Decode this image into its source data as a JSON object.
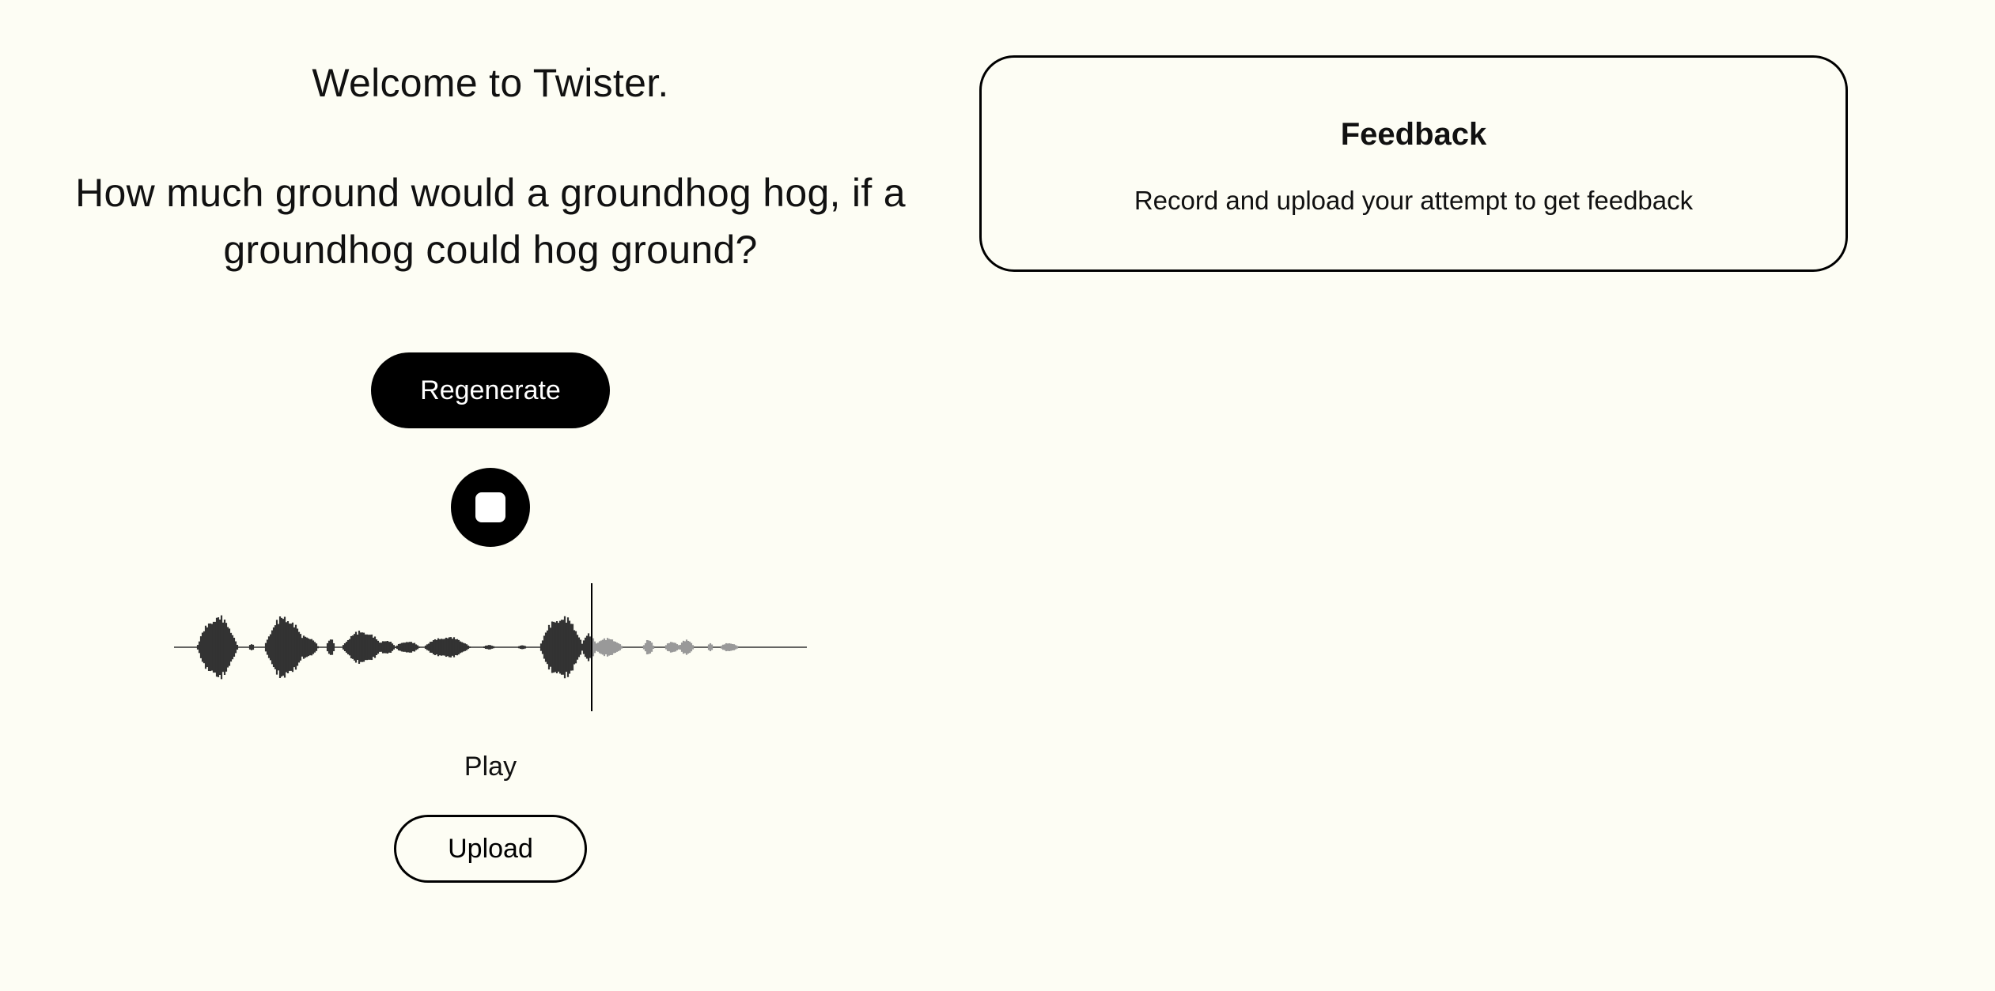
{
  "main": {
    "welcome": "Welcome to Twister.",
    "tongue_twister": "How much ground would a groundhog hog, if a groundhog could hog ground?",
    "regenerate_label": "Regenerate",
    "record_state": "recording-stop",
    "play_label": "Play",
    "upload_label": "Upload",
    "playback_progress": 0.66
  },
  "feedback": {
    "title": "Feedback",
    "message": "Record and upload your attempt to get feedback"
  },
  "colors": {
    "background": "#fdfdf4",
    "text": "#111111",
    "button": "#000000",
    "wave_played": "#333333",
    "wave_unplayed": "#999999"
  },
  "icons": {
    "record_button": "stop-icon"
  }
}
